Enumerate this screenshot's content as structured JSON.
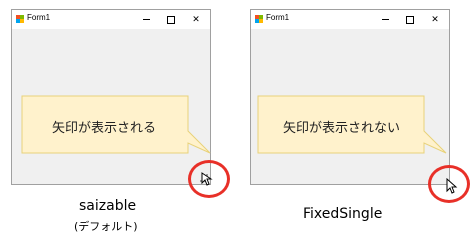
{
  "left": {
    "window_title": "Form1",
    "callout_text": "矢印が表示される",
    "caption_line1": "saizable",
    "caption_line2": "(デフォルト)"
  },
  "right": {
    "window_title": "Form1",
    "callout_text": "矢印が表示されない",
    "caption_line1": "FixedSingle"
  },
  "titlebar_buttons": {
    "close_label": "✕"
  },
  "colors": {
    "window_bg": "#f0f0f0",
    "callout_fill": "#fff2cc",
    "callout_stroke": "#e8d27a",
    "highlight_ring": "#e83028"
  },
  "icons": [
    "app-icon",
    "minimize-icon",
    "maximize-icon",
    "close-icon",
    "resize-grip-icon",
    "cursor-arrow-icon"
  ]
}
